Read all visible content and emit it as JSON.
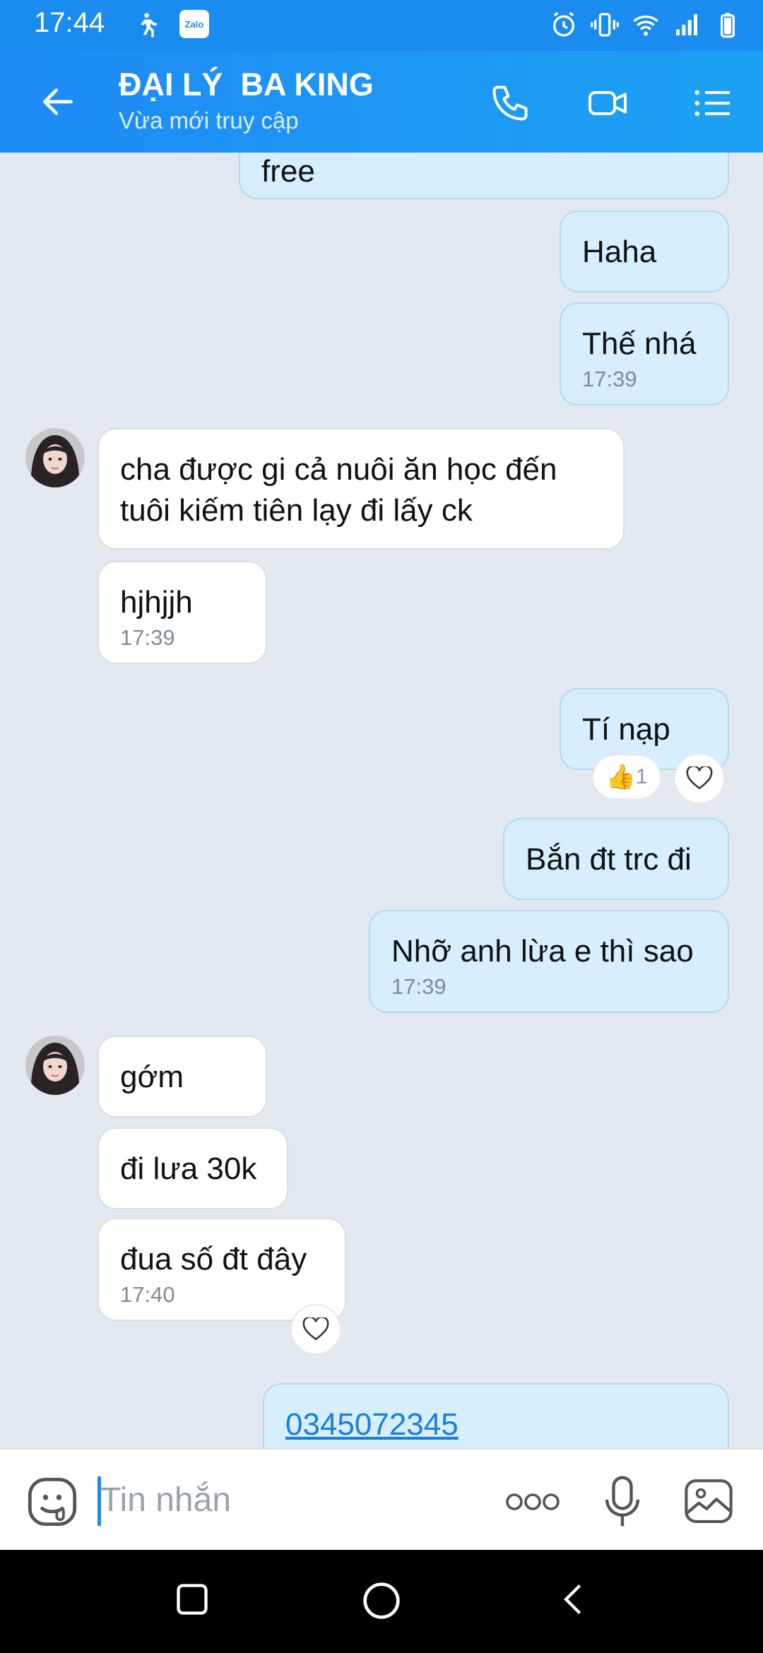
{
  "status_bar": {
    "time": "17:44",
    "zalo_badge": "Zalo"
  },
  "header": {
    "title": "ĐẠI LÝ  BA KING",
    "subtitle": "Vừa mới truy cập"
  },
  "messages": [
    {
      "from": "me",
      "text": "free",
      "time": ""
    },
    {
      "from": "me",
      "text": "Haha",
      "time": ""
    },
    {
      "from": "me",
      "text": "Thế nhá",
      "time": "17:39"
    },
    {
      "from": "them",
      "text": "cha được gi cả  nuôi ăn học đến tuôi kiếm tiên lạy đi lấy ck",
      "time": ""
    },
    {
      "from": "them",
      "text": "hjhjjh",
      "time": "17:39"
    },
    {
      "from": "me",
      "text": "Tí nạp",
      "time": "",
      "reaction": {
        "emoji": "👍",
        "count": "1"
      }
    },
    {
      "from": "me",
      "text": "Bắn đt trc đi",
      "time": ""
    },
    {
      "from": "me",
      "text": "Nhỡ anh lừa e thì sao",
      "time": "17:39"
    },
    {
      "from": "them",
      "text": "gớm",
      "time": ""
    },
    {
      "from": "them",
      "text": "đi lưa 30k",
      "time": ""
    },
    {
      "from": "them",
      "text": "đua số đt đây",
      "time": "17:40"
    },
    {
      "from": "me",
      "text": "0345072345",
      "time": ""
    }
  ],
  "input": {
    "placeholder": "Tin nhắn"
  },
  "icons": {
    "status": [
      "walk-icon",
      "zalo-icon",
      "alarm-icon",
      "vibrate-icon",
      "wifi-icon",
      "signal-icon",
      "battery-icon"
    ],
    "header": [
      "back-arrow-icon",
      "phone-icon",
      "video-icon",
      "menu-list-icon"
    ],
    "input": [
      "emoji-icon",
      "more-icon",
      "mic-icon",
      "image-icon"
    ],
    "nav": [
      "recents-icon",
      "home-icon",
      "back-icon"
    ]
  },
  "colors": {
    "accent": "#1a8cf0",
    "my_bubble": "#d6eefd",
    "their_bubble": "#ffffff",
    "chat_bg": "#e2e9f1"
  }
}
